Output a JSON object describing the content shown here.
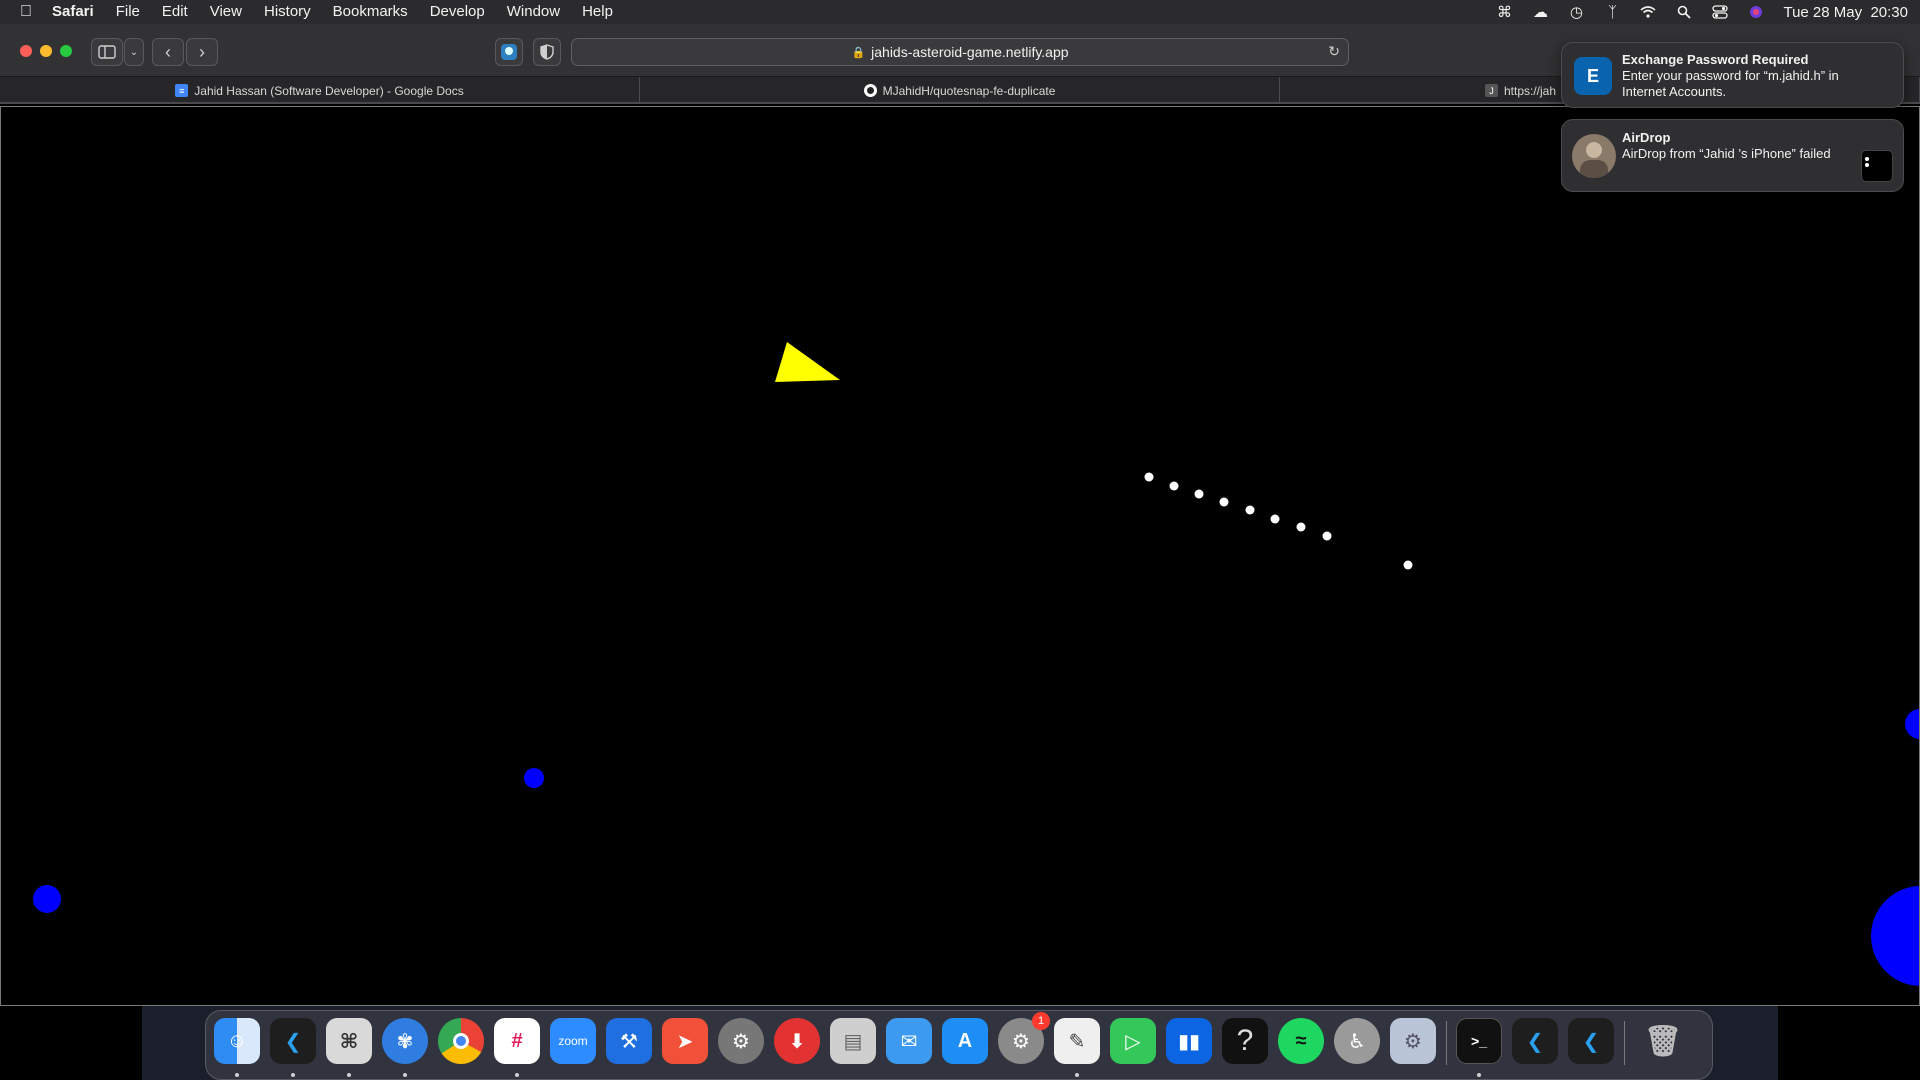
{
  "menubar": {
    "app_name": "Safari",
    "items": [
      "File",
      "Edit",
      "View",
      "History",
      "Bookmarks",
      "Develop",
      "Window",
      "Help"
    ],
    "clock": "Tue 28 May  20:30",
    "status_icons": [
      "command-icon",
      "cloud-icon",
      "time-machine-icon",
      "bluetooth-icon",
      "wifi-icon",
      "spotlight-icon",
      "control-center-icon",
      "siri-icon"
    ]
  },
  "toolbar": {
    "url": "jahids-asteroid-game.netlify.app"
  },
  "tabs": [
    {
      "label": "Jahid Hassan (Software Developer) - Google Docs",
      "icon": "google-docs-icon"
    },
    {
      "label": "MJahidH/quotesnap-fe-duplicate",
      "icon": "github-icon"
    },
    {
      "label": "https://jah",
      "icon": "j-favicon-icon"
    }
  ],
  "game": {
    "ship_color": "#ffff00",
    "bullet_color": "#ffffff",
    "asteroid_color": "#0000ff"
  },
  "notifications": [
    {
      "title": "Exchange Password Required",
      "body": "Enter your password for “m.jahid.h” in Internet Accounts.",
      "icon": "exchange-icon"
    },
    {
      "title": "AirDrop",
      "body": "AirDrop from “Jahid ’s iPhone” failed",
      "icon": "airdrop-thumbnail"
    }
  ],
  "dock": {
    "apps": [
      {
        "name": "Finder",
        "icon": "finder-icon",
        "color": "#3a8ef5",
        "running": true
      },
      {
        "name": "Visual Studio Code",
        "icon": "vscode-icon",
        "color": "#1e1e1e",
        "running": true
      },
      {
        "name": "Script Editor",
        "icon": "script-editor-icon",
        "color": "#d9d9d9",
        "running": true
      },
      {
        "name": "Safari",
        "icon": "safari-icon",
        "color": "#2f7de1",
        "running": true
      },
      {
        "name": "Chrome",
        "icon": "chrome-icon",
        "color": "#e8e8e8",
        "running": false
      },
      {
        "name": "Slack",
        "icon": "slack-icon",
        "color": "#ffffff",
        "running": true
      },
      {
        "name": "Zoom",
        "icon": "zoom-icon",
        "color": "#2d8cff",
        "label": "zoom",
        "running": false
      },
      {
        "name": "Xcode",
        "icon": "xcode-icon",
        "color": "#1f6fe0",
        "running": false
      },
      {
        "name": "Swift Playgrounds",
        "icon": "swift-icon",
        "color": "#f05138",
        "running": false
      },
      {
        "name": "Disk Utility",
        "icon": "disk-utility-icon",
        "color": "#777777",
        "running": false
      },
      {
        "name": "Downie",
        "icon": "downie-icon",
        "color": "#e23232",
        "running": false
      },
      {
        "name": "Archive Utility",
        "icon": "archive-icon",
        "color": "#cfcfcf",
        "running": false
      },
      {
        "name": "Mail",
        "icon": "mail-icon",
        "color": "#3c9af0",
        "running": false
      },
      {
        "name": "App Store",
        "icon": "app-store-icon",
        "color": "#1d8ef5",
        "running": false
      },
      {
        "name": "System Preferences",
        "icon": "system-preferences-icon",
        "color": "#8a8a8a",
        "badge": "1",
        "running": false
      },
      {
        "name": "TextEdit",
        "icon": "textedit-icon",
        "color": "#efefef",
        "running": true
      },
      {
        "name": "FaceTime",
        "icon": "facetime-icon",
        "color": "#34c759",
        "running": false
      },
      {
        "name": "Trello",
        "icon": "trello-icon",
        "color": "#0c66e4",
        "running": false
      },
      {
        "name": "Help",
        "icon": "question-icon",
        "color": "#111111",
        "running": false
      },
      {
        "name": "Spotify",
        "icon": "spotify-icon",
        "color": "#1ed760",
        "running": false
      },
      {
        "name": "Accessibility",
        "icon": "accessibility-icon",
        "color": "#9a9a9a",
        "running": false
      },
      {
        "name": "Settings",
        "icon": "gear-icon",
        "color": "#b9c4d6",
        "running": false
      },
      {
        "name": "Terminal",
        "icon": "terminal-icon",
        "color": "#111111",
        "running": true
      },
      {
        "name": "Visual Studio Code",
        "icon": "vscode-icon",
        "color": "#1e1e1e",
        "running": false
      },
      {
        "name": "Visual Studio Code",
        "icon": "vscode-icon",
        "color": "#1e1e1e",
        "running": false
      },
      {
        "name": "Trash",
        "icon": "trash-icon",
        "color": "#555555",
        "running": false
      }
    ]
  }
}
